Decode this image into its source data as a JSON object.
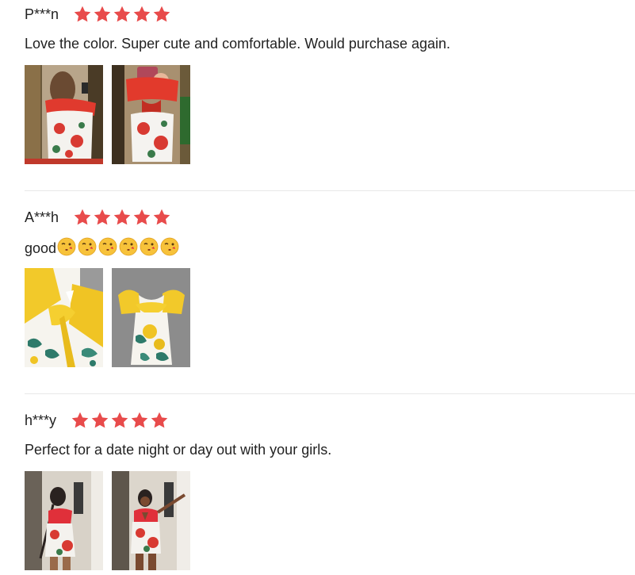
{
  "colors": {
    "star": "#e84b4b",
    "divider": "#e8e8e8",
    "text": "#222222"
  },
  "reviews": [
    {
      "author": "P***n",
      "rating": 5,
      "text": "Love the color. Super cute and comfortable. Would purchase again.",
      "photos": [
        {
          "alt": "Back view of red and white floral romper in mirror",
          "theme": "red-floral-back"
        },
        {
          "alt": "Front view of red and white floral romper in mirror",
          "theme": "red-floral-front"
        }
      ]
    },
    {
      "author": "A***h",
      "rating": 5,
      "text": "good",
      "emoji_count": 6,
      "emoji_icon": "kissing-face-icon",
      "photos": [
        {
          "alt": "Close-up of yellow tie top on floral romper",
          "theme": "yellow-floral-closeup"
        },
        {
          "alt": "Yellow and white floral romper laid flat",
          "theme": "yellow-floral-flat"
        }
      ]
    },
    {
      "author": "h***y",
      "rating": 5,
      "text": "Perfect for a date night or day out with your girls.",
      "photos": [
        {
          "alt": "Back view of red floral romper being worn",
          "theme": "red-floral-worn-back"
        },
        {
          "alt": "Front view of red floral romper being worn",
          "theme": "red-floral-worn-front"
        }
      ]
    }
  ]
}
